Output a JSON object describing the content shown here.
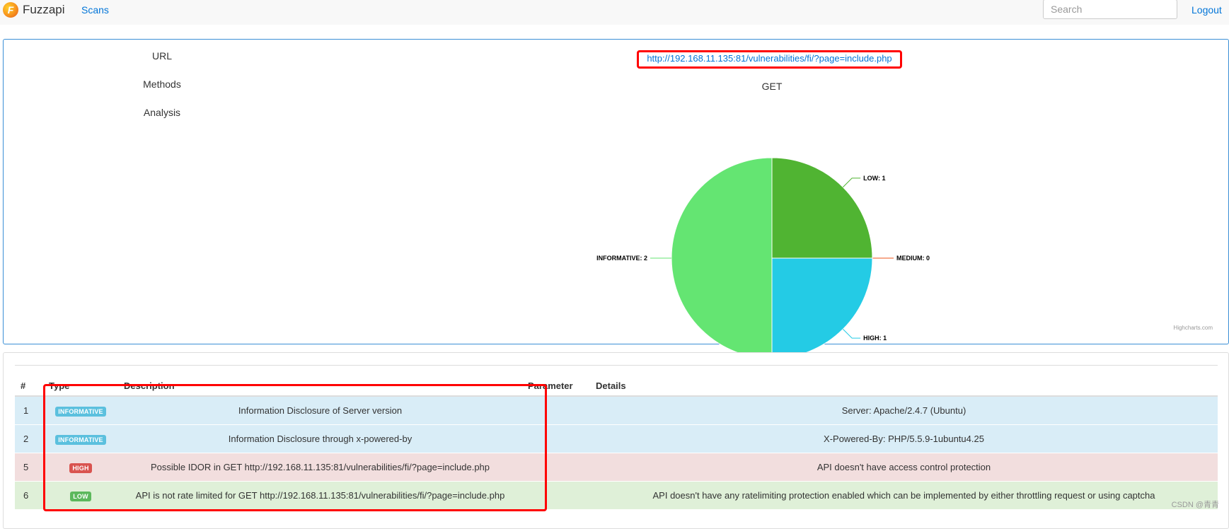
{
  "navbar": {
    "brand": "Fuzzapi",
    "logo_letter": "F",
    "scans_label": "Scans",
    "search_placeholder": "Search",
    "logout_label": "Logout"
  },
  "info": {
    "url_label": "URL",
    "methods_label": "Methods",
    "analysis_label": "Analysis",
    "url_value": "http://192.168.11.135:81/vulnerabilities/fi/?page=include.php",
    "method_value": "GET"
  },
  "chart_data": {
    "type": "pie",
    "title": "",
    "categories": [
      "LOW",
      "MEDIUM",
      "HIGH",
      "INFORMATIVE"
    ],
    "values": [
      1,
      0,
      1,
      2
    ],
    "labels": [
      "LOW: 1",
      "MEDIUM: 0",
      "HIGH: 1",
      "INFORMATIVE: 2"
    ],
    "colors": [
      "#50b432",
      "#ed561b",
      "#24cbe5",
      "#64e572"
    ],
    "credits": "Highcharts.com"
  },
  "table": {
    "headers": [
      "#",
      "Type",
      "Description",
      "Parameter",
      "Details"
    ],
    "rows": [
      {
        "num": "1",
        "type": "INFORMATIVE",
        "description": "Information Disclosure of Server version",
        "parameter": "",
        "details": "Server: Apache/2.4.7 (Ubuntu)"
      },
      {
        "num": "2",
        "type": "INFORMATIVE",
        "description": "Information Disclosure through x-powered-by",
        "parameter": "",
        "details": "X-Powered-By: PHP/5.5.9-1ubuntu4.25"
      },
      {
        "num": "5",
        "type": "HIGH",
        "description": "Possible IDOR in GET http://192.168.11.135:81/vulnerabilities/fi/?page=include.php",
        "parameter": "",
        "details": "API doesn't have access control protection"
      },
      {
        "num": "6",
        "type": "LOW",
        "description": "API is not rate limited for GET http://192.168.11.135:81/vulnerabilities/fi/?page=include.php",
        "parameter": "",
        "details": "API doesn't have any ratelimiting protection enabled which can be implemented by either throttling request or using captcha"
      }
    ]
  },
  "watermark": "CSDN @青青",
  "colors": {
    "link": "#0275d8",
    "highlight": "#ff0000",
    "row_info": "#d9edf7",
    "row_high": "#f2dede",
    "row_low": "#dff0d8"
  }
}
